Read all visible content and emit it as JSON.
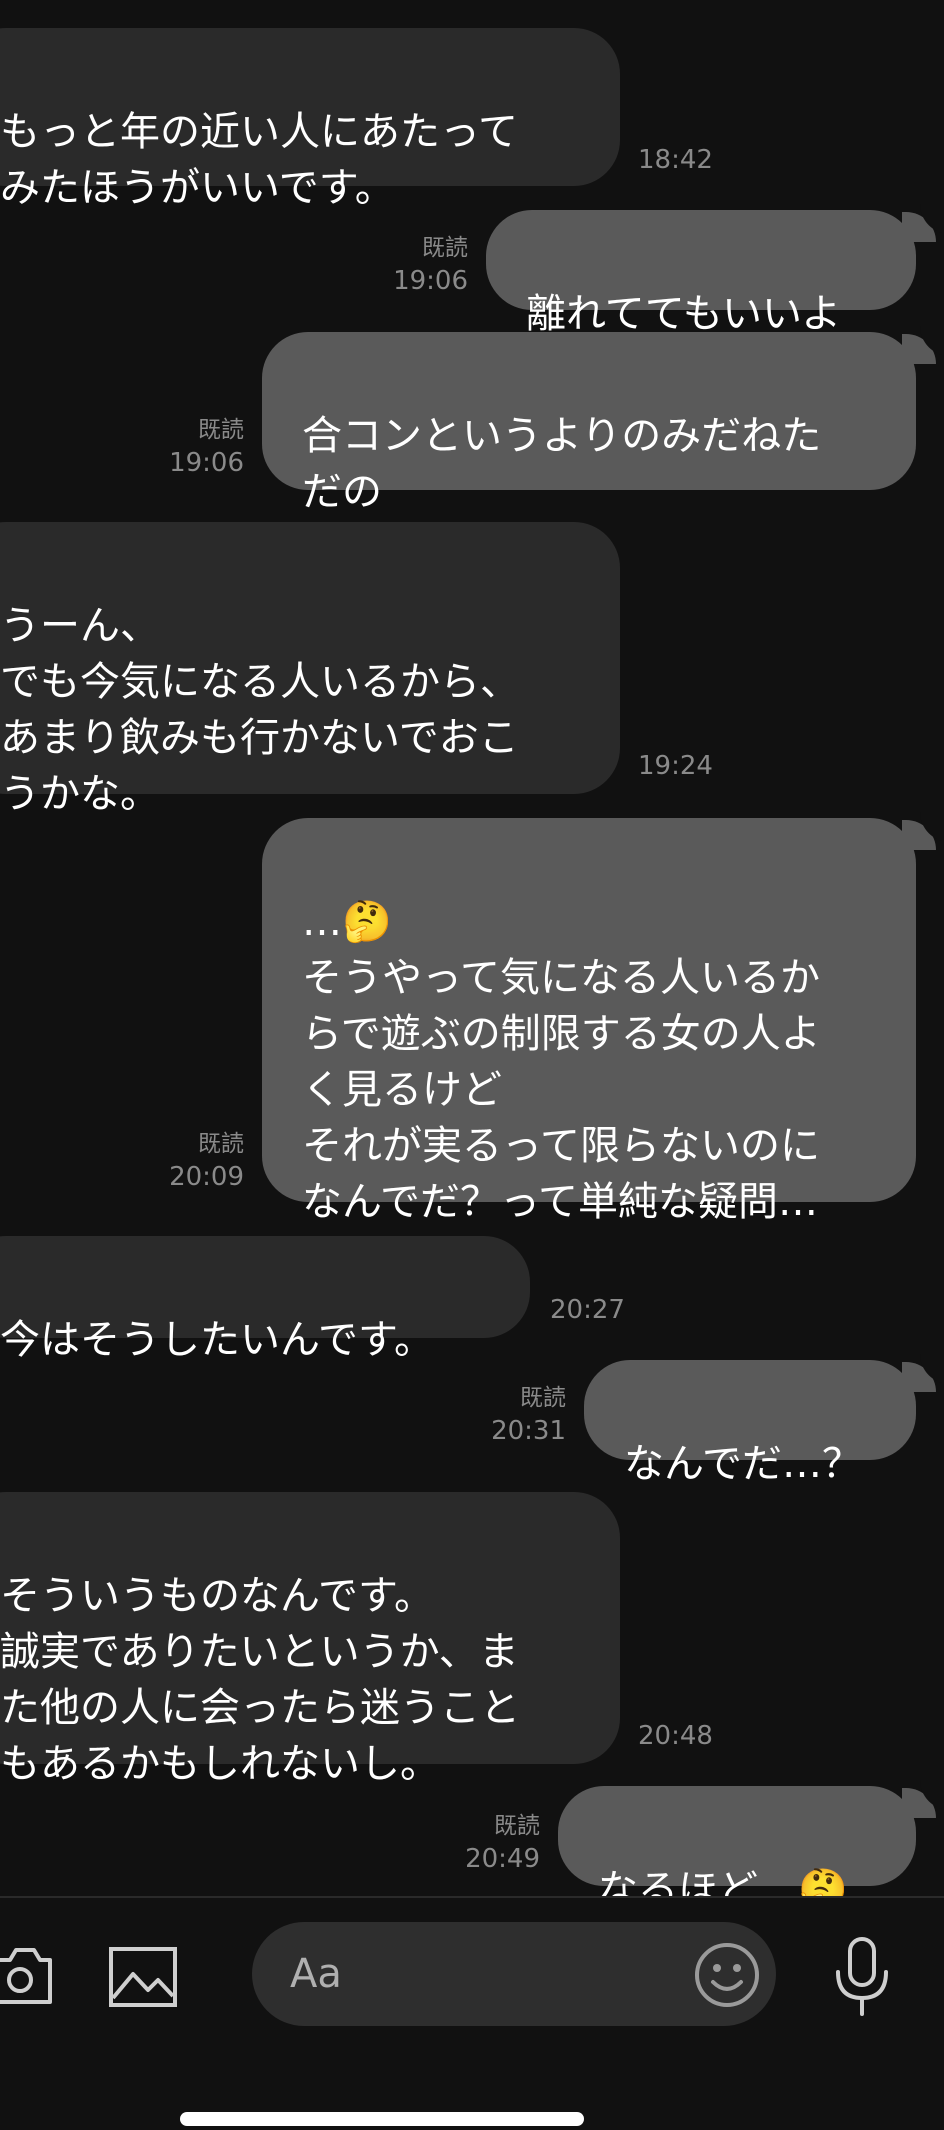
{
  "messages": [
    {
      "dir": "in",
      "text": "もっと年の近い人にあたって\nみたほうがいいです。",
      "time": "18:42"
    },
    {
      "dir": "out",
      "text": "離れててもいいよ",
      "read": "既読",
      "time": "19:06"
    },
    {
      "dir": "out",
      "text": "合コンというよりのみだねた\nだの",
      "read": "既読",
      "time": "19:06"
    },
    {
      "dir": "in",
      "text": "うーん、\nでも今気になる人いるから、\nあまり飲みも行かないでおこ\nうかな。",
      "time": "19:24"
    },
    {
      "dir": "out",
      "text": "…🤔\nそうやって気になる人いるか\nらで遊ぶの制限する女の人よ\nく見るけど\nそれが実るって限らないのに\nなんでだ？って単純な疑問…",
      "read": "既読",
      "time": "20:09"
    },
    {
      "dir": "in",
      "text": "今はそうしたいんです。",
      "time": "20:27"
    },
    {
      "dir": "out",
      "text": "なんでだ…？",
      "read": "既読",
      "time": "20:31"
    },
    {
      "dir": "in",
      "text": "そういうものなんです。\n誠実でありたいというか、ま\nた他の人に会ったら迷うこと\nもあるかもしれないし。",
      "time": "20:48"
    },
    {
      "dir": "out",
      "text": "なるほど…🤔",
      "read": "既読",
      "time": "20:49"
    }
  ],
  "input": {
    "placeholder": "Aa"
  },
  "icons": {
    "camera": "camera-icon",
    "image": "image-icon",
    "emoji": "emoji-icon",
    "mic": "microphone-icon"
  }
}
